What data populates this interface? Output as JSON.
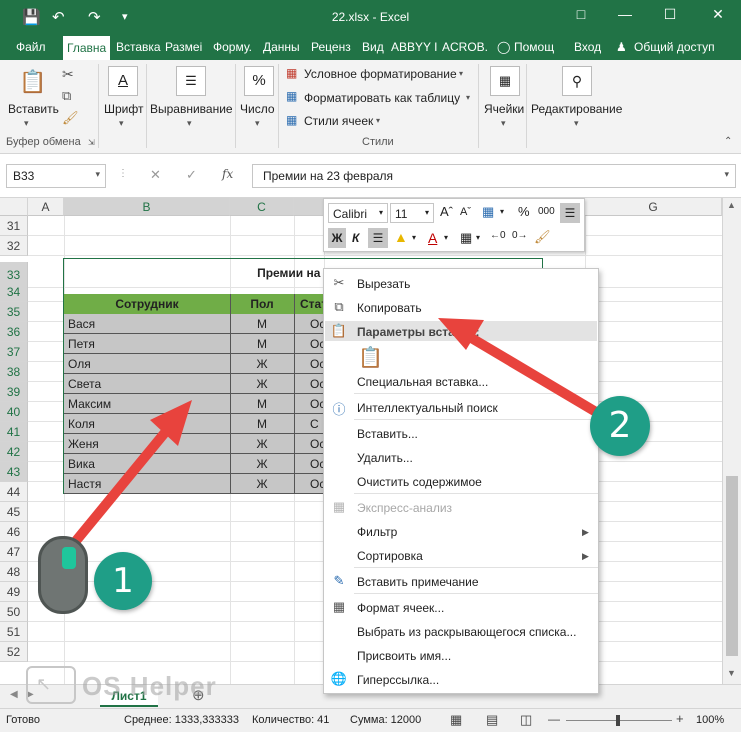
{
  "window": {
    "title": "22.xlsx - Excel"
  },
  "tabs": [
    {
      "label": "Файл"
    },
    {
      "label": "Главна"
    },
    {
      "label": "Вставка"
    },
    {
      "label": "Размеі"
    },
    {
      "label": "Форму."
    },
    {
      "label": "Данны"
    },
    {
      "label": "Реценз"
    },
    {
      "label": "Вид"
    },
    {
      "label": "ABBYY I"
    },
    {
      "label": "ACROB."
    },
    {
      "label": "Помощ"
    },
    {
      "label": "Вход"
    },
    {
      "label": "Общий доступ"
    }
  ],
  "ribbon": {
    "paste_label": "Вставить",
    "clipboard_group": "Буфер обмена",
    "font_label": "Шрифт",
    "align_label": "Выравнивание",
    "number_label": "Число",
    "cond_format": "Условное форматирование",
    "format_table": "Форматировать как таблицу",
    "cell_styles": "Стили ячеек",
    "styles_group": "Стили",
    "cells_label": "Ячейки",
    "editing_label": "Редактирование",
    "number_icon": "%",
    "font_icon": "A"
  },
  "formula_bar": {
    "name_box": "B33",
    "fx": "fx",
    "formula": "Премии на 23 февраля"
  },
  "columns": [
    "A",
    "B",
    "C",
    "G"
  ],
  "rows": [
    "31",
    "32",
    "33",
    "34",
    "35",
    "36",
    "37",
    "38",
    "39",
    "40",
    "41",
    "42",
    "43",
    "44",
    "45",
    "46",
    "47",
    "48",
    "49",
    "50",
    "51",
    "52"
  ],
  "table": {
    "title": "Премии на 23 ф",
    "headers": [
      "Сотрудник",
      "Пол",
      "Стат"
    ],
    "rows": [
      [
        "Вася",
        "М",
        "Ос"
      ],
      [
        "Петя",
        "М",
        "Ос"
      ],
      [
        "Оля",
        "Ж",
        "Ос"
      ],
      [
        "Света",
        "Ж",
        "Ос"
      ],
      [
        "Максим",
        "М",
        "Ос"
      ],
      [
        "Коля",
        "М",
        "С"
      ],
      [
        "Женя",
        "Ж",
        "Ос"
      ],
      [
        "Вика",
        "Ж",
        "Ос"
      ],
      [
        "Настя",
        "Ж",
        "Ос"
      ]
    ]
  },
  "mini_toolbar": {
    "font": "Calibri",
    "size": "11",
    "bold": "Ж",
    "italic": "К",
    "percent": "%",
    "thousands": "000"
  },
  "context_menu": {
    "cut": "Вырезать",
    "copy": "Копировать",
    "paste_options": "Параметры вставки:",
    "paste_special": "Специальная вставка...",
    "smart_lookup": "Интеллектуальный поиск",
    "insert": "Вставить...",
    "delete": "Удалить...",
    "clear": "Очистить содержимое",
    "quick_analysis": "Экспресс-анализ",
    "filter": "Фильтр",
    "sort": "Сортировка",
    "comment": "Вставить примечание",
    "format_cells": "Формат ячеек...",
    "pick_list": "Выбрать из раскрывающегося списка...",
    "define_name": "Присвоить имя...",
    "hyperlink": "Гиперссылка..."
  },
  "sheet": {
    "tab": "Лист1",
    "watermark": "OS Helper"
  },
  "status": {
    "ready": "Готово",
    "average": "Среднее: 1333,333333",
    "count": "Количество: 41",
    "sum": "Сумма: 12000",
    "zoom": "100%"
  },
  "annotations": {
    "badge1": "1",
    "badge2": "2"
  },
  "colors": {
    "excel_green": "#217346",
    "header_fill": "#70ad47",
    "selection_fill": "#c6c6c6",
    "arrow": "#e8433d",
    "badge": "#1f9e87"
  }
}
